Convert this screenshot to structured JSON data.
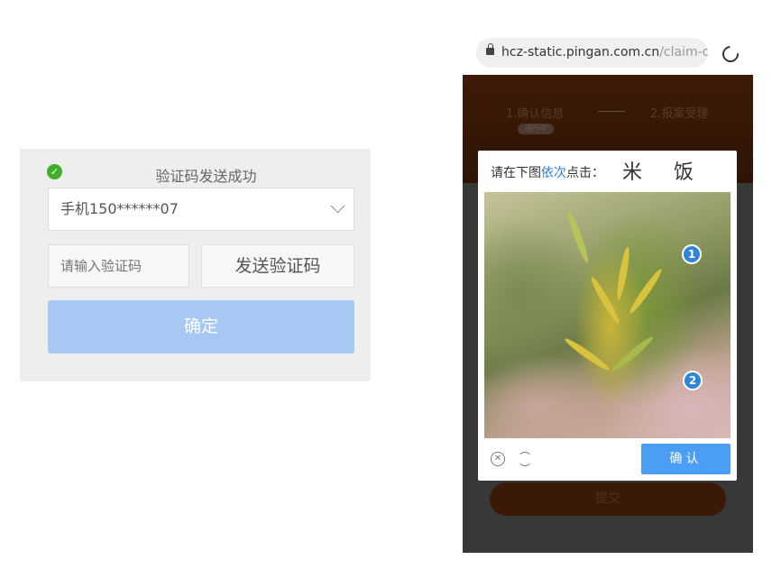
{
  "sms_panel": {
    "status_message": "验证码发送成功",
    "phone_select_value": "手机150******07",
    "code_input_placeholder": "请输入验证码",
    "send_code_label": "发送验证码",
    "confirm_label": "确定",
    "status_color": "#3fae2a",
    "confirm_color": "#a6c8f2"
  },
  "browser": {
    "url_host": "hcz-static.pingan.com.cn",
    "url_path": "/claim-ce"
  },
  "page": {
    "steps": [
      {
        "label": "1.确认信息",
        "badge": "进行中"
      },
      {
        "label": "2.报案受理"
      }
    ],
    "submit_label": "提交"
  },
  "captcha": {
    "prompt_prefix": "请在下图",
    "prompt_highlight": "依次",
    "prompt_suffix": "点击：",
    "target_chars": "米 饭",
    "markers": [
      "1",
      "2"
    ],
    "confirm_label": "确认",
    "accent_color": "#4b9ef5"
  }
}
